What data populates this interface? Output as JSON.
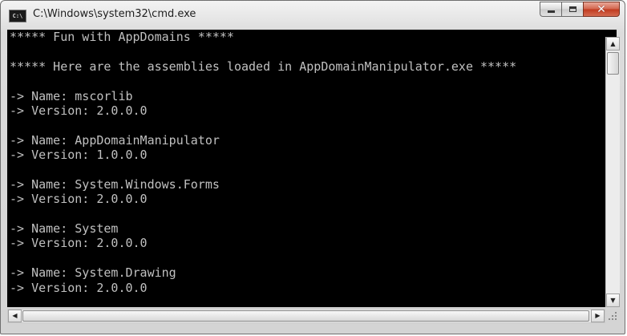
{
  "window": {
    "title": "C:\\Windows\\system32\\cmd.exe",
    "icon_label": "C:\\",
    "controls": {
      "minimize": "minimize-icon",
      "maximize": "maximize-icon",
      "close": "close-icon"
    }
  },
  "console": {
    "background": "#000000",
    "foreground": "#c0c0c0",
    "lines": [
      "***** Fun with AppDomains *****",
      "",
      "***** Here are the assemblies loaded in AppDomainManipulator.exe *****",
      "",
      "-> Name: mscorlib",
      "-> Version: 2.0.0.0",
      "",
      "-> Name: AppDomainManipulator",
      "-> Version: 1.0.0.0",
      "",
      "-> Name: System.Windows.Forms",
      "-> Version: 2.0.0.0",
      "",
      "-> Name: System",
      "-> Version: 2.0.0.0",
      "",
      "-> Name: System.Drawing",
      "-> Version: 2.0.0.0"
    ]
  },
  "scrollbars": {
    "up_arrow": "▲",
    "down_arrow": "▼",
    "left_arrow": "◀",
    "right_arrow": "▶"
  }
}
